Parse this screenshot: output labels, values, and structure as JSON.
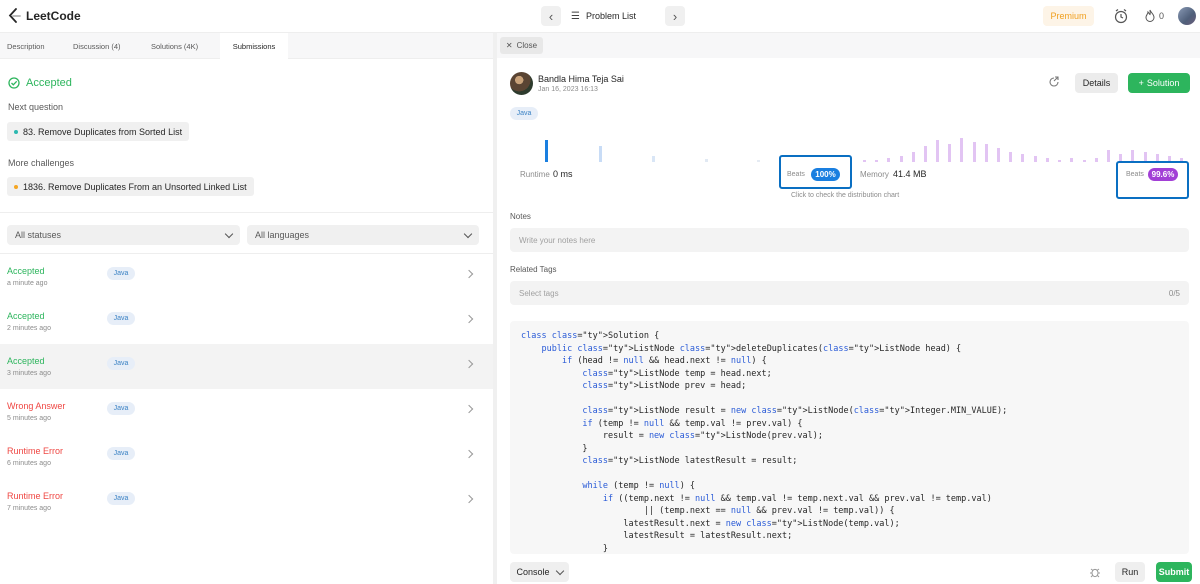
{
  "header": {
    "logo_text": "LeetCode",
    "problem_list_label": "Problem List",
    "premium_label": "Premium",
    "streak_count": "0"
  },
  "left": {
    "tabs": [
      {
        "label": "Description"
      },
      {
        "label": "Discussion (4)"
      },
      {
        "label": "Solutions (4K)"
      },
      {
        "label": "Submissions"
      }
    ],
    "result_status": "Accepted",
    "next_question_label": "Next question",
    "next_question": "83. Remove Duplicates from Sorted List",
    "more_challenges_label": "More challenges",
    "more_challenge": "1836. Remove Duplicates From an Unsorted Linked List",
    "status_filter": "All statuses",
    "language_filter": "All languages",
    "submissions": [
      {
        "status": "Accepted",
        "time": "a minute ago",
        "lang": "Java"
      },
      {
        "status": "Accepted",
        "time": "2 minutes ago",
        "lang": "Java"
      },
      {
        "status": "Accepted",
        "time": "3 minutes ago",
        "lang": "Java"
      },
      {
        "status": "Wrong Answer",
        "time": "5 minutes ago",
        "lang": "Java"
      },
      {
        "status": "Runtime Error",
        "time": "6 minutes ago",
        "lang": "Java"
      },
      {
        "status": "Runtime Error",
        "time": "7 minutes ago",
        "lang": "Java"
      }
    ]
  },
  "right": {
    "close_label": "Close",
    "user_name": "Bandla Hima Teja Sai",
    "date": "Jan 16, 2023 16:13",
    "details_label": "Details",
    "solution_label": "Solution",
    "lang_tag": "Java",
    "runtime_label": "Runtime",
    "runtime_value": "0 ms",
    "runtime_beats_label": "Beats",
    "runtime_beats": "100%",
    "memory_label": "Memory",
    "memory_value": "41.4 MB",
    "memory_beats_label": "Beats",
    "memory_beats": "99.6%",
    "chart_hint": "Click to check the distribution chart",
    "notes_label": "Notes",
    "notes_placeholder": "Write your notes here",
    "tags_label": "Related Tags",
    "tags_placeholder": "Select tags",
    "tags_count": "0/5",
    "code_lines": [
      "class Solution {",
      "    public ListNode deleteDuplicates(ListNode head) {",
      "        if (head != null && head.next != null) {",
      "            ListNode temp = head.next;",
      "            ListNode prev = head;",
      "",
      "            ListNode result = new ListNode(Integer.MIN_VALUE);",
      "            if (temp != null && temp.val != prev.val) {",
      "                result = new ListNode(prev.val);",
      "            }",
      "            ListNode latestResult = result;",
      "",
      "            while (temp != null) {",
      "                if ((temp.next != null && temp.val != temp.next.val && prev.val != temp.val)",
      "                        || (temp.next == null && prev.val != temp.val)) {",
      "                    latestResult.next = new ListNode(temp.val);",
      "                    latestResult = latestResult.next;",
      "                }"
    ],
    "console_label": "Console",
    "run_label": "Run",
    "submit_label": "Submit"
  },
  "colors": {
    "accent_green": "#2db55d",
    "error_red": "#ef4743",
    "runtime_blue": "#1a7fe0",
    "memory_purple": "#a23fd6",
    "annotation_blue": "#0a6fc2"
  }
}
